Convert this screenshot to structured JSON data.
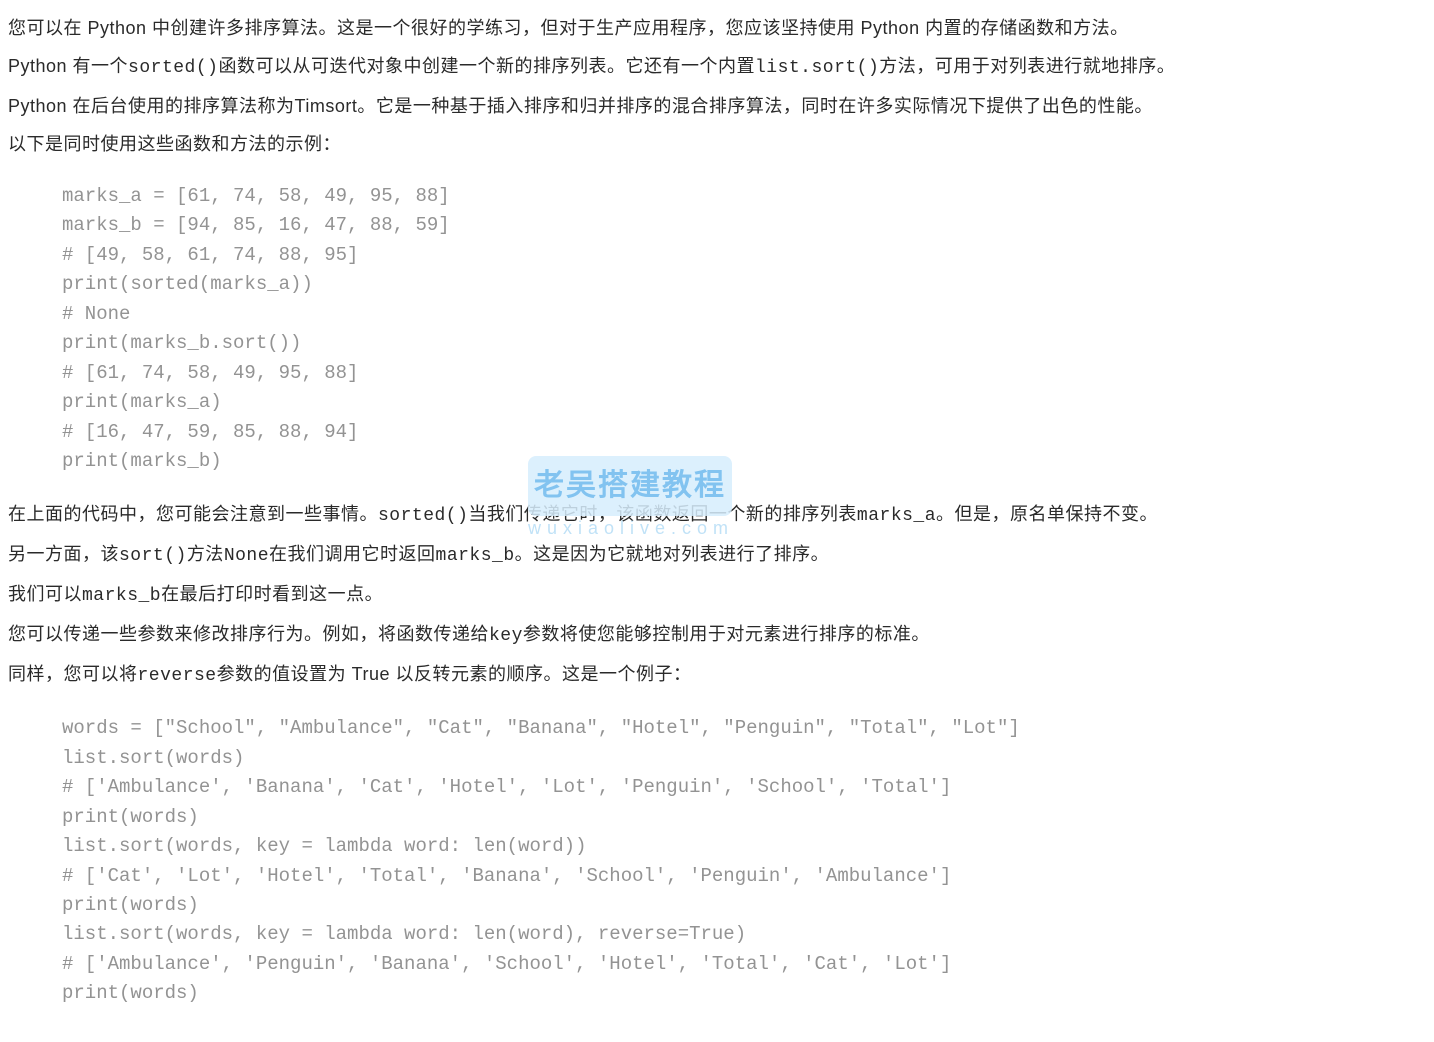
{
  "paragraphs": {
    "p1_a": "您可以在 Python 中创建许多排序算法。这是一个很好的学练习，但对于生产应用程序，您应该坚持使用 Python 内置的存储函数和方法。",
    "p2_a": "Python 有一个",
    "p2_code1": "sorted()",
    "p2_b": "函数可以从可迭代对象中创建一个新的排序列表。它还有一个内置",
    "p2_code2": "list.sort()",
    "p2_c": "方法，可用于对列表进行就地排序。",
    "p3_a": "Python 在后台使用的排序算法称为Timsort。它是一种基于插入排序和归并排序的混合排序算法，同时在许多实际情况下提供了出色的性能。",
    "p4_a": "以下是同时使用这些函数和方法的示例：",
    "p5_a": "在上面的代码中，您可能会注意到一些事情。",
    "p5_code1": "sorted()",
    "p5_b": "当我们传递它时，该函数返回一个新的排序列表",
    "p5_code2": "marks_a",
    "p5_c": "。但是，原名单保持不变。",
    "p6_a": "另一方面，该",
    "p6_code1": "sort()",
    "p6_b": "方法",
    "p6_code2": "None",
    "p6_c": "在我们调用它时返回",
    "p6_code3": "marks_b",
    "p6_d": "。这是因为它就地对列表进行了排序。",
    "p7_a": "我们可以",
    "p7_code1": "marks_b",
    "p7_b": "在最后打印时看到这一点。",
    "p8_a": "您可以传递一些参数来修改排序行为。例如，将函数传递给",
    "p8_code1": "key",
    "p8_b": "参数将使您能够控制用于对元素进行排序的标准。",
    "p9_a": "同样，您可以将",
    "p9_code1": "reverse",
    "p9_b": "参数的值设置为 True 以反转元素的顺序。这是一个例子："
  },
  "code_block_1": "marks_a = [61, 74, 58, 49, 95, 88]\nmarks_b = [94, 85, 16, 47, 88, 59]\n# [49, 58, 61, 74, 88, 95]\nprint(sorted(marks_a))\n# None\nprint(marks_b.sort())\n# [61, 74, 58, 49, 95, 88]\nprint(marks_a)\n# [16, 47, 59, 85, 88, 94]\nprint(marks_b)",
  "code_block_2": "words = [\"School\", \"Ambulance\", \"Cat\", \"Banana\", \"Hotel\", \"Penguin\", \"Total\", \"Lot\"]\nlist.sort(words)\n# ['Ambulance', 'Banana', 'Cat', 'Hotel', 'Lot', 'Penguin', 'School', 'Total']\nprint(words)\nlist.sort(words, key = lambda word: len(word))\n# ['Cat', 'Lot', 'Hotel', 'Total', 'Banana', 'School', 'Penguin', 'Ambulance']\nprint(words)\nlist.sort(words, key = lambda word: len(word), reverse=True)\n# ['Ambulance', 'Penguin', 'Banana', 'School', 'Hotel', 'Total', 'Cat', 'Lot']\nprint(words)",
  "watermark": {
    "main": "老吴搭建教程",
    "sub": "wuxiaolive.com"
  }
}
